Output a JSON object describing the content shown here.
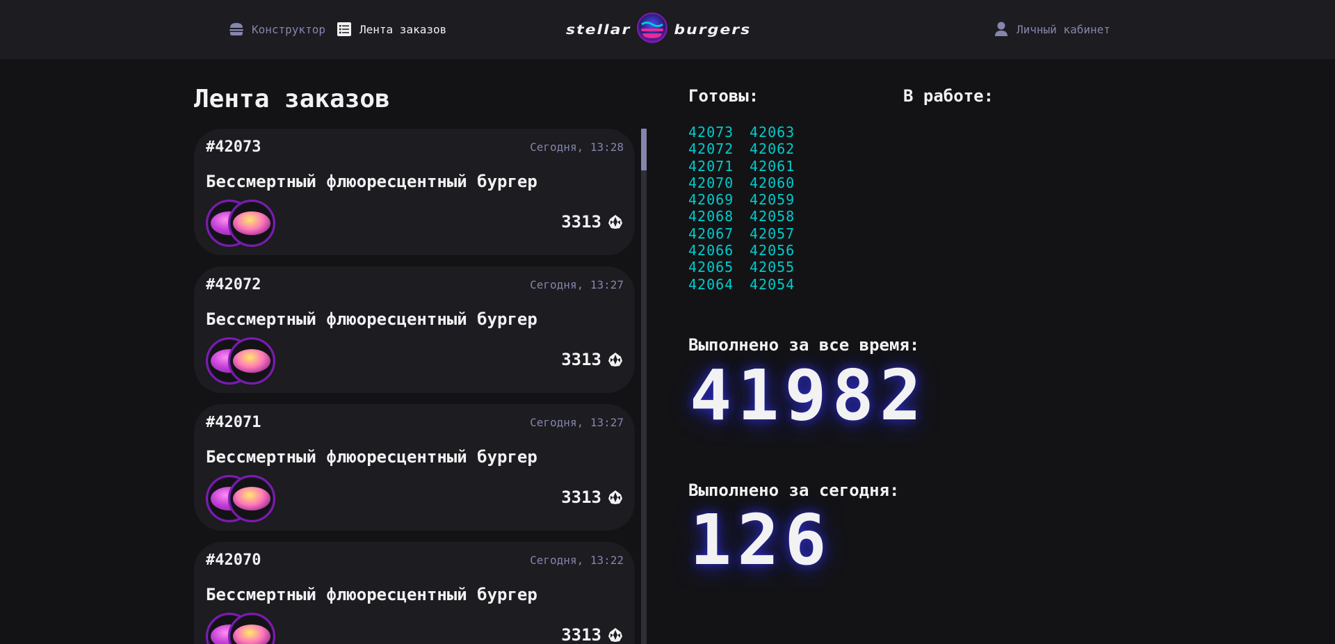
{
  "header": {
    "nav": {
      "constructor_label": "Конструктор",
      "feed_label": "Лента заказов",
      "account_label": "Личный кабинет"
    },
    "logo": {
      "left_word": "stellar",
      "right_word": "burgers"
    }
  },
  "main": {
    "title": "Лента заказов",
    "orders": [
      {
        "number": "#42073",
        "date": "Сегодня, 13:28",
        "name": "Бессмертный флюоресцентный бургер",
        "price": "3313"
      },
      {
        "number": "#42072",
        "date": "Сегодня, 13:27",
        "name": "Бессмертный флюоресцентный бургер",
        "price": "3313"
      },
      {
        "number": "#42071",
        "date": "Сегодня, 13:27",
        "name": "Бессмертный флюоресцентный бургер",
        "price": "3313"
      },
      {
        "number": "#42070",
        "date": "Сегодня, 13:22",
        "name": "Бессмертный флюоресцентный бургер",
        "price": "3313"
      }
    ]
  },
  "stats": {
    "ready_title": "Готовы:",
    "in_work_title": "В работе:",
    "ready": [
      "42073",
      "42063",
      "42072",
      "42062",
      "42071",
      "42061",
      "42070",
      "42060",
      "42069",
      "42059",
      "42068",
      "42058",
      "42067",
      "42057",
      "42066",
      "42056",
      "42065",
      "42055",
      "42064",
      "42054"
    ],
    "total_title": "Выполнено за все время:",
    "total_value": "41982",
    "today_title": "Выполнено за сегодня:",
    "today_value": "126"
  },
  "colors": {
    "background": "#131316",
    "panel": "#1c1c21",
    "accent_text": "#00cccc",
    "muted_text": "#8585ad",
    "ingredient_border": "#801ab2"
  }
}
